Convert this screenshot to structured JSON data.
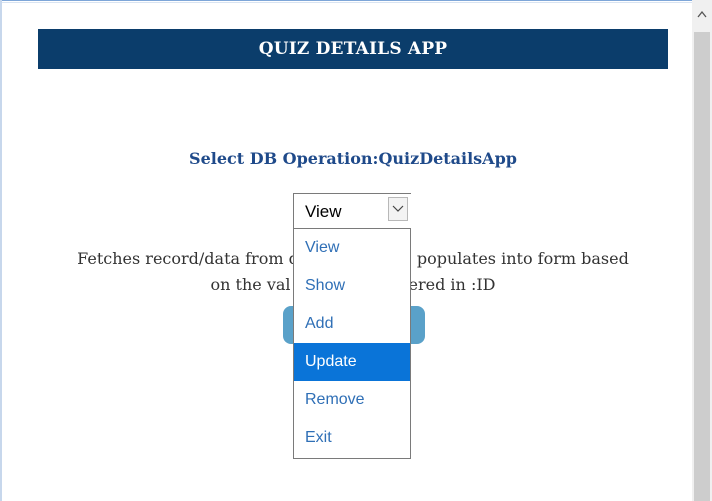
{
  "header": {
    "title": "QUIZ DETAILS APP"
  },
  "main": {
    "select_label": "Select DB Operation:QuizDetailsApp",
    "select_value": "View",
    "description_line1": "Fetches record/data from d",
    "description_line1b": "populates into form based",
    "description_line2a": "on the val",
    "description_line2b": "ered in :ID"
  },
  "dropdown": {
    "options": [
      "View",
      "Show",
      "Add",
      "Update",
      "Remove",
      "Exit"
    ],
    "highlighted": "Update"
  },
  "colors": {
    "banner": "#0b3d6b",
    "label": "#1f4a8a",
    "option_text": "#2f6fb6",
    "highlight": "#0a74d8",
    "button": "#5aa1c9"
  },
  "icons": {
    "select_arrow": "chevron-down-icon",
    "scroll_up": "chevron-up-icon"
  }
}
